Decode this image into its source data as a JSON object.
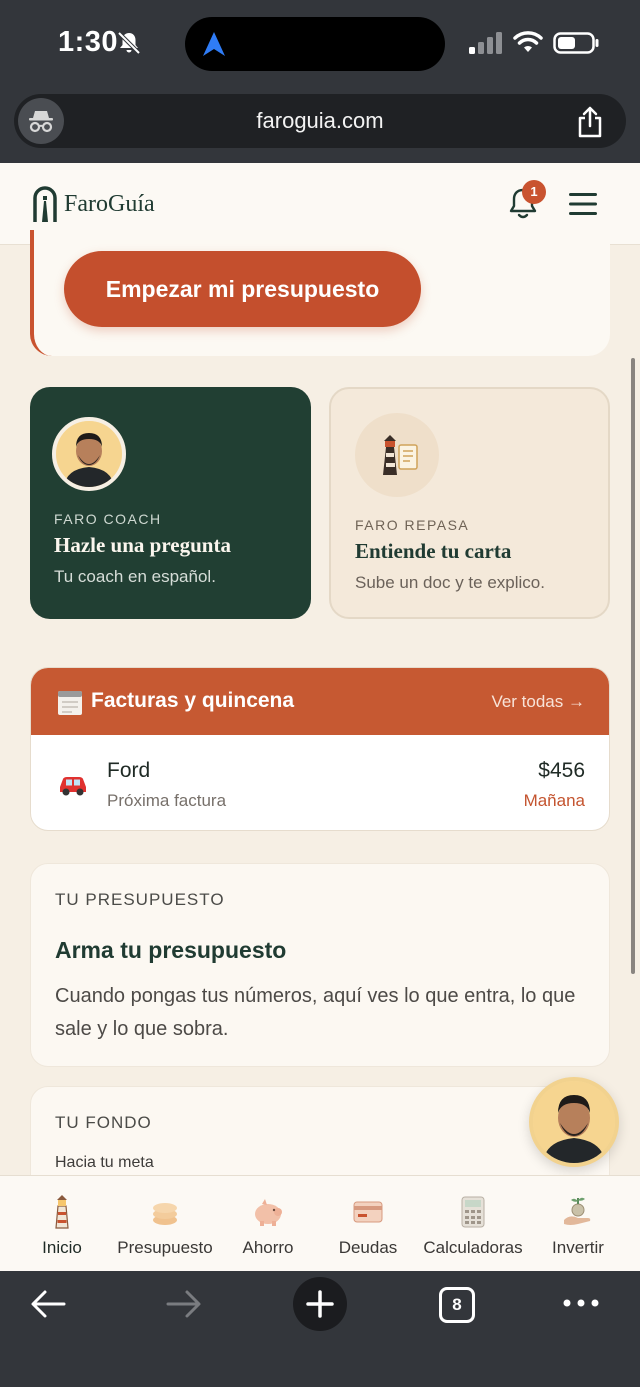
{
  "status_bar": {
    "time": "1:30",
    "icons": [
      "bell-slash-icon",
      "navigation-arrow-icon",
      "signal-icon",
      "wifi-icon",
      "battery-icon"
    ]
  },
  "browser": {
    "url": "faroguia.com",
    "icons": [
      "incognito-icon",
      "share-icon"
    ]
  },
  "header": {
    "brand": "FaroGuía",
    "notification_count": "1",
    "icons": [
      "logo-icon",
      "bell-icon",
      "menu-icon"
    ]
  },
  "hero": {
    "cta_label": "Empezar mi presupuesto"
  },
  "cards": {
    "coach": {
      "kicker": "FARO COACH",
      "title": "Hazle una pregunta",
      "subtitle": "Tu coach en español."
    },
    "repasa": {
      "kicker": "FARO REPASA",
      "title": "Entiende tu carta",
      "subtitle": "Sube un doc y te explico."
    }
  },
  "bills": {
    "title": "Facturas y quincena",
    "link": "Ver todas →",
    "items": [
      {
        "name": "Ford",
        "sub": "Próxima factura",
        "amount": "$456",
        "due": "Mañana"
      }
    ]
  },
  "budget": {
    "kicker": "TU PRESUPUESTO",
    "title": "Arma tu presupuesto",
    "body": "Cuando pongas tus números, aquí ves lo que entra, lo que sale y lo que sobra."
  },
  "fund": {
    "kicker": "TU FONDO",
    "subtitle": "Hacia tu meta"
  },
  "tabs": [
    {
      "label": "Inicio",
      "icon": "lighthouse-icon"
    },
    {
      "label": "Presupuesto",
      "icon": "coins-icon"
    },
    {
      "label": "Ahorro",
      "icon": "piggy-bank-icon"
    },
    {
      "label": "Deudas",
      "icon": "card-icon"
    },
    {
      "label": "Calculadoras",
      "icon": "calculator-icon"
    },
    {
      "label": "Invertir",
      "icon": "money-plant-icon"
    }
  ],
  "toolbar": {
    "tab_count": "8"
  },
  "colors": {
    "brand_green": "#213f33",
    "brand_orange": "#c44f2d",
    "background": "#f6efe4"
  }
}
